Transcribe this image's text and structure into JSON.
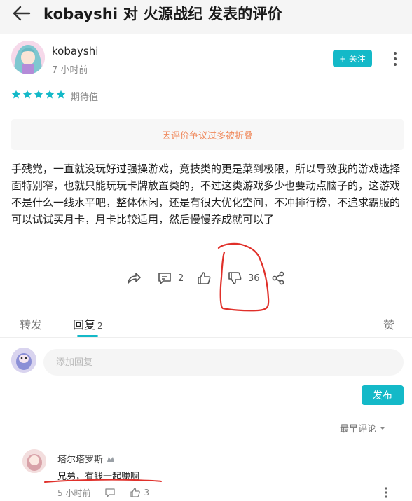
{
  "header": {
    "title": "kobayshi 对 火源战纪 发表的评价",
    "back_icon": "arrow-left-icon"
  },
  "author": {
    "name": "kobayshi",
    "time": "7 小时前",
    "follow_label": "+ 关注"
  },
  "rating": {
    "stars": 5,
    "max": 5,
    "label": "期待值",
    "star_color": "#14b9c8"
  },
  "folded_notice": "因评价争议过多被折叠",
  "review_text": "手残党，一直就没玩好过强操游戏，竞技类的更是菜到极限，所以导致我的游戏选择面特别窄，也就只能玩玩卡牌放置类的，不过这类游戏多少也要动点脑子的，这游戏不是什么一线水平吧，整体休闲，还是有很大优化空间，不冲排行榜，不追求霸服的可以试试买月卡，月卡比较适用，然后慢慢养成就可以了",
  "actions": {
    "comment_count": "2",
    "dislike_count": "36"
  },
  "tabs": {
    "forward": "转发",
    "reply": "回复",
    "reply_count": "2",
    "like": "赞"
  },
  "reply_box": {
    "placeholder": "添加回复",
    "publish_label": "发布"
  },
  "sort": {
    "label": "最早评论"
  },
  "comments": [
    {
      "name": "塔尔塔罗斯",
      "text": "兄弟，有钱一起赚啊",
      "time": "5 小时前",
      "like_count": "3"
    }
  ],
  "colors": {
    "accent": "#14b9c8",
    "folded_text": "#f08a5d",
    "annotation": "#e0302a"
  }
}
